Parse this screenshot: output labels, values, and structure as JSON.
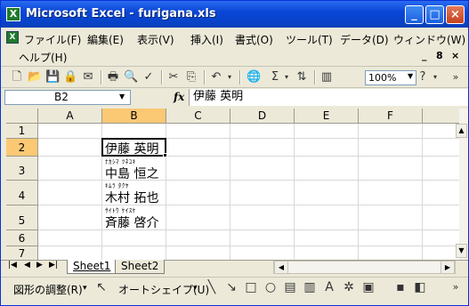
{
  "window": {
    "title": "Microsoft Excel - furigana.xls",
    "app_icon_text": "X",
    "minimize": "_",
    "maximize": "□",
    "close": "×"
  },
  "menu": {
    "items": [
      "ファイル(F)",
      "編集(E)",
      "表示(V)",
      "挿入(I)",
      "書式(O)",
      "ツール(T)",
      "データ(D)",
      "ウィンドウ(W)"
    ],
    "help": "ヘルプ(H)",
    "doc_controls": [
      "_",
      "8",
      "×"
    ]
  },
  "toolbar": {
    "zoom": "100%",
    "overflow": "»"
  },
  "formula_bar": {
    "name_box": "B2",
    "fx": "fx",
    "value": "伊藤 英明"
  },
  "grid": {
    "columns": [
      "A",
      "B",
      "C",
      "D",
      "E",
      "F"
    ],
    "rows": [
      "1",
      "2",
      "3",
      "4",
      "5",
      "6",
      "7"
    ],
    "cells": [
      {
        "row": "2",
        "furigana": "",
        "text": "伊藤 英明"
      },
      {
        "row": "3",
        "furigana": "ﾅｶｼﾏ ﾂﾈﾕｷ",
        "text": "中島 恒之"
      },
      {
        "row": "4",
        "furigana": "ｷﾑﾗ ﾀｸﾔ",
        "text": "木村 拓也"
      },
      {
        "row": "5",
        "furigana": "ｻｲﾄｳ ｹｲｽｹ",
        "text": "斉藤 啓介"
      }
    ]
  },
  "sheets": {
    "tabs": [
      "Sheet1",
      "Sheet2"
    ],
    "active": "Sheet1"
  },
  "drawing_toolbar": {
    "adjust_label": "図形の調整(R)",
    "autoshape_label": "オートシェイプ(U)"
  }
}
